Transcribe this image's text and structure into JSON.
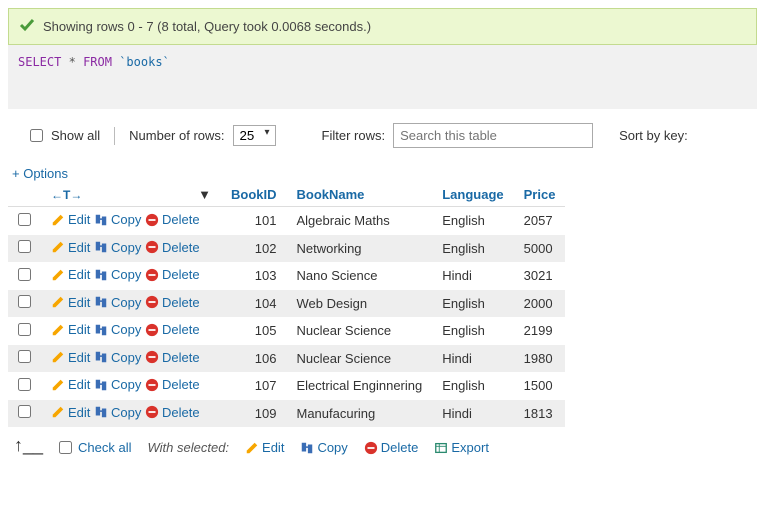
{
  "success_message": "Showing rows 0 - 7 (8 total, Query took 0.0068 seconds.)",
  "sql": {
    "select": "SELECT",
    "star": "*",
    "from": "FROM",
    "table": "`books`"
  },
  "controls": {
    "show_all": "Show all",
    "num_rows_label": "Number of rows:",
    "num_rows_value": "25",
    "filter_label": "Filter rows:",
    "filter_placeholder": "Search this table",
    "sort_label": "Sort by key:"
  },
  "options_label": "+ Options",
  "sort_arrows_label": "←T→",
  "columns": [
    "BookID",
    "BookName",
    "Language",
    "Price"
  ],
  "actions": {
    "edit": "Edit",
    "copy": "Copy",
    "delete": "Delete"
  },
  "rows": [
    {
      "id": "101",
      "name": "Algebraic Maths",
      "lang": "English",
      "price": "2057"
    },
    {
      "id": "102",
      "name": "Networking",
      "lang": "English",
      "price": "5000"
    },
    {
      "id": "103",
      "name": "Nano Science",
      "lang": "Hindi",
      "price": "3021"
    },
    {
      "id": "104",
      "name": "Web Design",
      "lang": "English",
      "price": "2000"
    },
    {
      "id": "105",
      "name": "Nuclear Science",
      "lang": "English",
      "price": "2199"
    },
    {
      "id": "106",
      "name": "Nuclear Science",
      "lang": "Hindi",
      "price": "1980"
    },
    {
      "id": "107",
      "name": "Electrical Enginnering",
      "lang": "English",
      "price": "1500"
    },
    {
      "id": "109",
      "name": "Manufacuring",
      "lang": "Hindi",
      "price": "1813"
    }
  ],
  "footer": {
    "check_all": "Check all",
    "with_selected": "With selected:",
    "edit": "Edit",
    "copy": "Copy",
    "delete": "Delete",
    "export": "Export"
  }
}
